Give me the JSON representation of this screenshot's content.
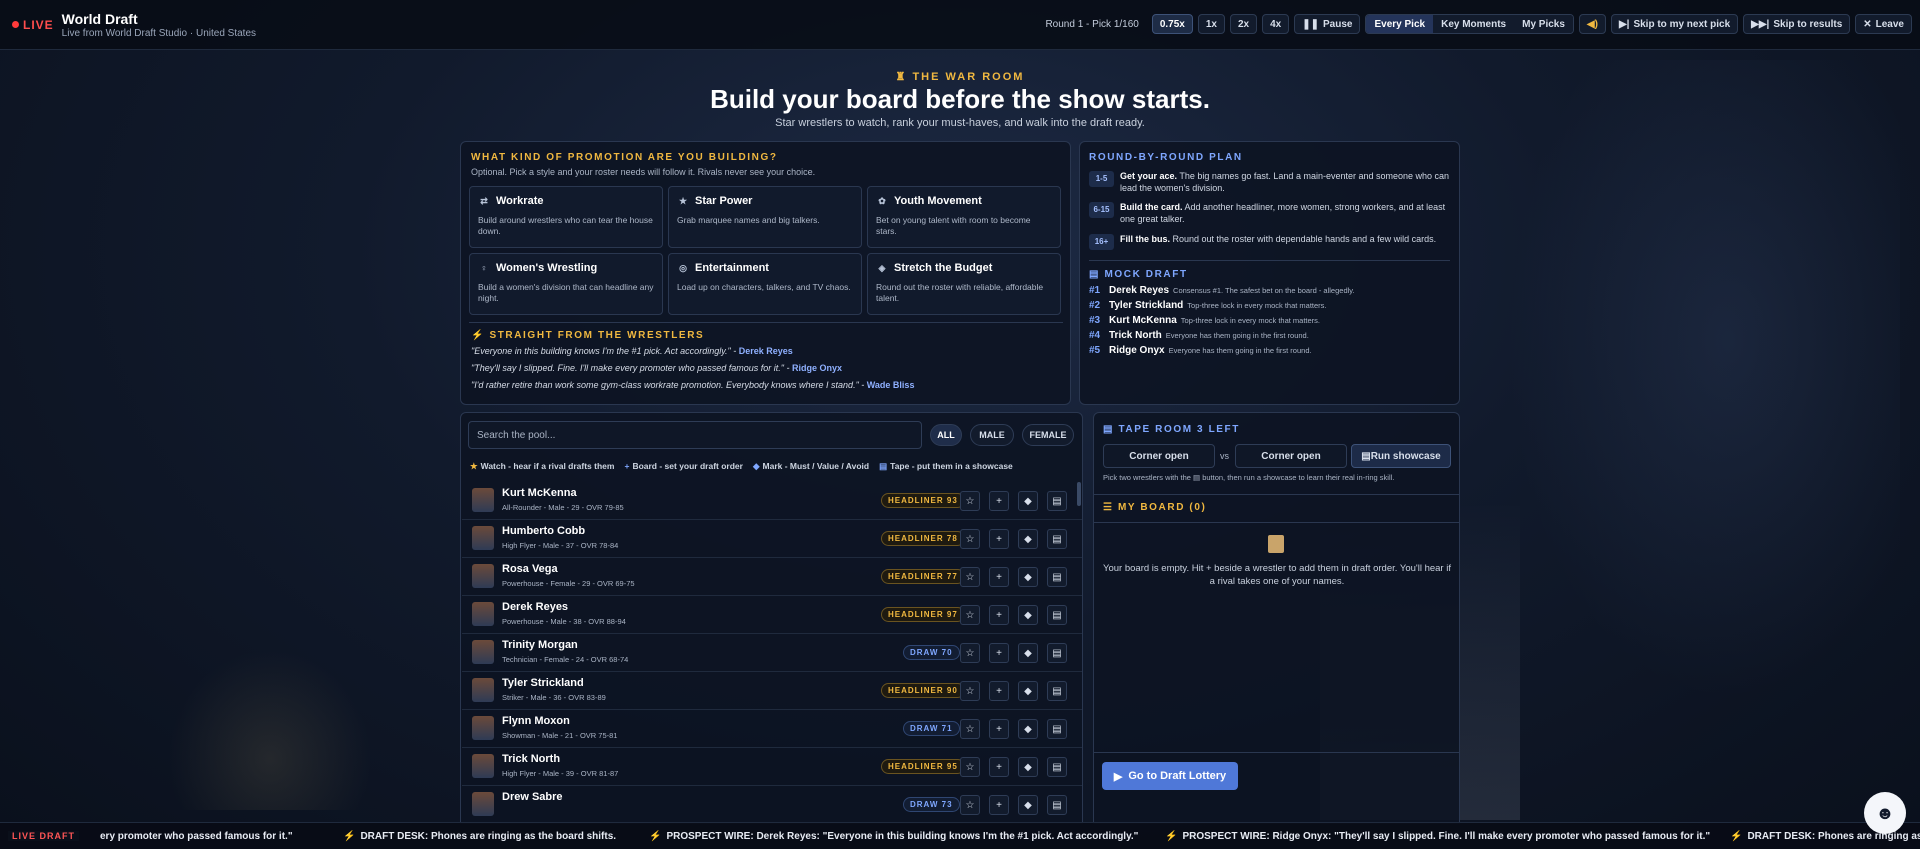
{
  "topbar": {
    "live": "LIVE",
    "title": "World Draft",
    "subtitle": "Live from World Draft Studio · United States",
    "round": "Round 1 - Pick 1/160",
    "speeds": [
      "0.75x",
      "1x",
      "2x",
      "4x"
    ],
    "active_speed": "0.75x",
    "pause": "Pause",
    "views": [
      "Every Pick",
      "Key Moments",
      "My Picks"
    ],
    "active_view": "Every Pick",
    "skip_next": "Skip to my next pick",
    "skip_results": "Skip to results",
    "leave": "Leave"
  },
  "hero": {
    "kicker": "THE WAR ROOM",
    "title": "Build your board before the show starts.",
    "subtitle": "Star wrestlers to watch, rank your must-haves, and walk into the draft ready."
  },
  "promotion": {
    "title": "WHAT KIND OF PROMOTION ARE YOU BUILDING?",
    "note": "Optional. Pick a style and your roster needs will follow it. Rivals never see your choice.",
    "cards": [
      {
        "title": "Workrate",
        "desc": "Build around wrestlers who can tear the house down.",
        "icon": "arrows-icon"
      },
      {
        "title": "Star Power",
        "desc": "Grab marquee names and big talkers.",
        "icon": "star-icon"
      },
      {
        "title": "Youth Movement",
        "desc": "Bet on young talent with room to become stars.",
        "icon": "sprout-icon"
      },
      {
        "title": "Women's Wrestling",
        "desc": "Build a women's division that can headline any night.",
        "icon": "venus-icon"
      },
      {
        "title": "Entertainment",
        "desc": "Load up on characters, talkers, and TV chaos.",
        "icon": "mic-icon"
      },
      {
        "title": "Stretch the Budget",
        "desc": "Round out the roster with reliable, affordable talent.",
        "icon": "coins-icon"
      }
    ]
  },
  "quotes": {
    "title": "STRAIGHT FROM THE WRESTLERS",
    "items": [
      {
        "text": "\"Everyone in this building knows I'm the #1 pick. Act accordingly.\" - ",
        "who": "Derek Reyes"
      },
      {
        "text": "\"They'll say I slipped. Fine. I'll make every promoter who passed famous for it.\" - ",
        "who": "Ridge Onyx"
      },
      {
        "text": "\"I'd rather retire than work some gym-class workrate promotion. Everybody knows where I stand.\" - ",
        "who": "Wade Bliss"
      }
    ]
  },
  "plan": {
    "title": "ROUND-BY-ROUND PLAN",
    "rows": [
      {
        "badge": "1-5",
        "lead": "Get your ace.",
        "text": " The big names go fast. Land a main-eventer and someone who can lead the women's division."
      },
      {
        "badge": "6-15",
        "lead": "Build the card.",
        "text": " Add another headliner, more women, strong workers, and at least one great talker."
      },
      {
        "badge": "16+",
        "lead": "Fill the bus.",
        "text": " Round out the roster with dependable hands and a few wild cards."
      }
    ]
  },
  "mock": {
    "title": "MOCK DRAFT",
    "rows": [
      {
        "n": "#1",
        "name": "Derek Reyes",
        "desc": "Consensus #1. The safest bet on the board - allegedly."
      },
      {
        "n": "#2",
        "name": "Tyler Strickland",
        "desc": "Top-three lock in every mock that matters."
      },
      {
        "n": "#3",
        "name": "Kurt McKenna",
        "desc": "Top-three lock in every mock that matters."
      },
      {
        "n": "#4",
        "name": "Trick North",
        "desc": "Everyone has them going in the first round."
      },
      {
        "n": "#5",
        "name": "Ridge Onyx",
        "desc": "Everyone has them going in the first round."
      }
    ]
  },
  "pool": {
    "search_placeholder": "Search the pool...",
    "filters": [
      "ALL",
      "MALE",
      "FEMALE"
    ],
    "active_filter": "ALL",
    "legend": [
      {
        "icon": "★",
        "text": "Watch - hear if a rival drafts them"
      },
      {
        "icon": "+",
        "text": "Board - set your draft order"
      },
      {
        "icon": "◆",
        "text": "Mark - Must / Value / Avoid"
      },
      {
        "icon": "▤",
        "text": "Tape - put them in a showcase"
      }
    ],
    "wrestlers": [
      {
        "name": "Kurt McKenna",
        "desc": "All-Rounder - Male - 29 - OVR 79-85",
        "tag": "HEADLINER 93",
        "tier": "headliner"
      },
      {
        "name": "Humberto Cobb",
        "desc": "High Flyer - Male - 37 - OVR 78-84",
        "tag": "HEADLINER 78",
        "tier": "headliner"
      },
      {
        "name": "Rosa Vega",
        "desc": "Powerhouse - Female - 29 - OVR 69-75",
        "tag": "HEADLINER 77",
        "tier": "headliner"
      },
      {
        "name": "Derek Reyes",
        "desc": "Powerhouse - Male - 38 - OVR 88-94",
        "tag": "HEADLINER 97",
        "tier": "headliner"
      },
      {
        "name": "Trinity Morgan",
        "desc": "Technician - Female - 24 - OVR 68-74",
        "tag": "DRAW 70",
        "tier": "draw"
      },
      {
        "name": "Tyler Strickland",
        "desc": "Striker - Male - 36 - OVR 83-89",
        "tag": "HEADLINER 90",
        "tier": "headliner"
      },
      {
        "name": "Flynn Moxon",
        "desc": "Showman - Male - 21 - OVR 75-81",
        "tag": "DRAW 71",
        "tier": "draw"
      },
      {
        "name": "Trick North",
        "desc": "High Flyer - Male - 39 - OVR 81-87",
        "tag": "HEADLINER 95",
        "tier": "headliner"
      },
      {
        "name": "Drew Sabre",
        "desc": "",
        "tag": "DRAW 73",
        "tier": "draw"
      }
    ]
  },
  "tape": {
    "title": "TAPE ROOM 3 LEFT",
    "corner_a": "Corner open",
    "vs": "vs",
    "corner_b": "Corner open",
    "run": "Run showcase",
    "help": "Pick two wrestlers with the ▤ button, then run a showcase to learn their real in-ring skill."
  },
  "board": {
    "title": "MY BOARD (0)",
    "empty": "Your board is empty. Hit + beside a wrestler to add them in draft order. You'll hear if a rival takes one of your names.",
    "cta": "Go to Draft Lottery"
  },
  "ticker": {
    "live": "LIVE DRAFT",
    "items": [
      "ery promoter who passed famous for it.\"",
      "DRAFT DESK: Phones are ringing as the board shifts.",
      "PROSPECT WIRE: Derek Reyes: \"Everyone in this building knows I'm the #1 pick. Act accordingly.\"",
      "PROSPECT WIRE: Ridge Onyx: \"They'll say I slipped. Fine. I'll make every promoter who passed famous for it.\"",
      "DRAFT DESK: Phones are ringing as the"
    ]
  },
  "colors": {
    "accent_gold": "#f0b840",
    "accent_blue": "#7fa7ff",
    "live_red": "#ff3b3b",
    "cta_blue": "#4f78d8"
  }
}
